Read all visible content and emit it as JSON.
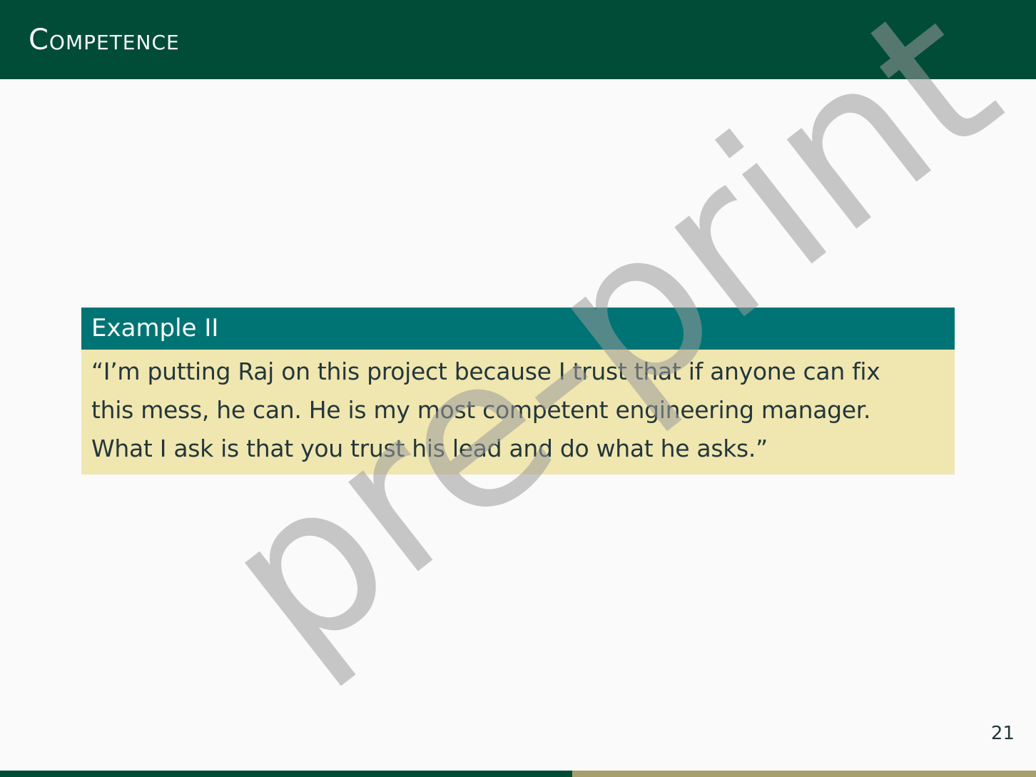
{
  "frame": {
    "title": "Competence",
    "page_number": "21"
  },
  "example_block": {
    "title": "Example II",
    "lines": [
      "“I’m putting Raj on this project because I trust that if anyone can fix",
      "this mess, he can.  He is my most competent engineering manager.",
      "What I ask is that you trust his lead and do what he asks.”"
    ]
  },
  "watermark": {
    "text": "pre-print"
  },
  "progress": {
    "fraction": 0.552
  },
  "colors": {
    "header": "#004c37",
    "block_title": "#007474",
    "block_body": "#f0e6b0",
    "progress_done": "#004c37",
    "progress_remaining": "#a89d6c"
  }
}
